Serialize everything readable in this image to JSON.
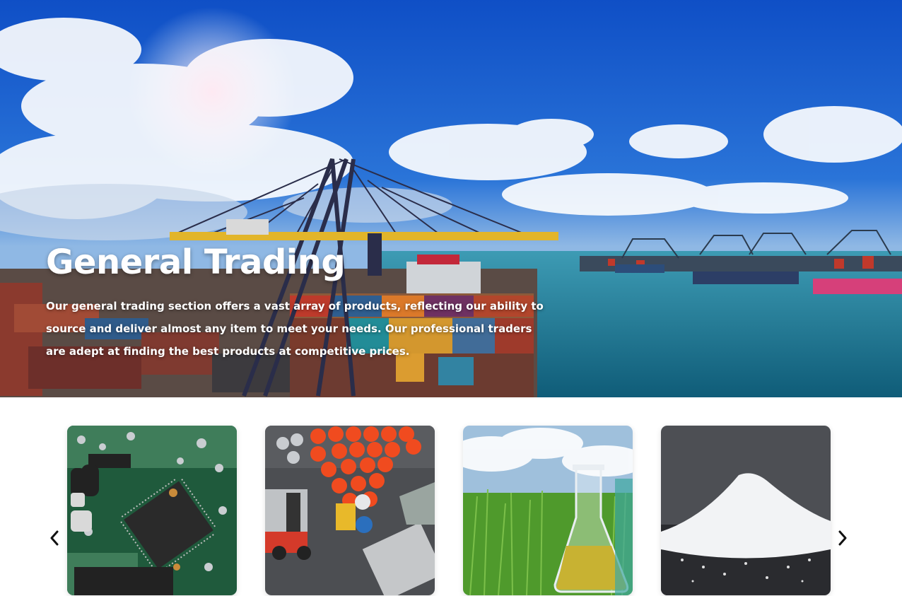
{
  "hero": {
    "title": "General Trading",
    "description": "Our general trading section offers a vast array of products, reflecting our ability to source and deliver almost any item to meet your needs. Our professional traders are adept at finding the best products at competitive prices."
  },
  "carousel": {
    "items": [
      {
        "image": "circuit-board-chip"
      },
      {
        "image": "chemical-drums-forklift"
      },
      {
        "image": "flask-in-field"
      },
      {
        "image": "white-powder-pile"
      }
    ],
    "prev_icon": "chevron-left-icon",
    "next_icon": "chevron-right-icon"
  },
  "colors": {
    "sky": "#1d6ad8",
    "sea": "#1b6f8f",
    "crane": "#e2b52a"
  }
}
